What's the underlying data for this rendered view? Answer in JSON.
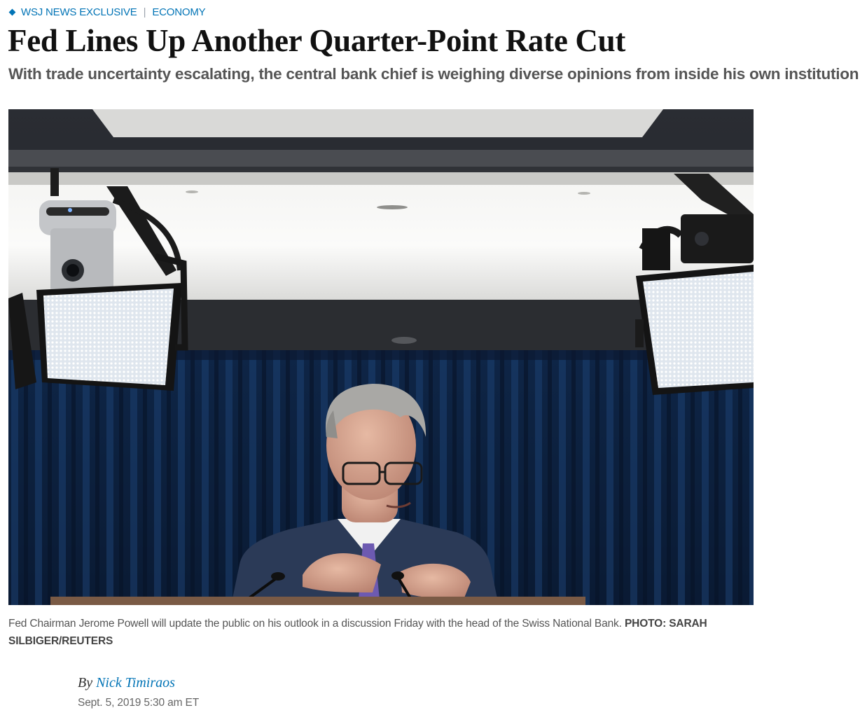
{
  "article": {
    "flashline": "WSJ NEWS EXCLUSIVE",
    "section": "ECONOMY",
    "headline": "Fed Lines Up Another Quarter-Point Rate Cut",
    "dek": "With trade uncertainty escalating, the central bank chief is weighing diverse opinions from inside his own institution",
    "caption": {
      "text": "Fed Chairman Jerome Powell will update the public on his outlook in a discussion Friday with the head of the Swiss National Bank. ",
      "credit": "PHOTO: SARAH SILBIGER/REUTERS"
    },
    "byline": {
      "prefix": "By",
      "author": "Nick Timiraos"
    },
    "timestamp": "Sept. 5, 2019 5:30 am ET"
  },
  "colors": {
    "accent": "#0274b6",
    "headline": "#111111",
    "dek": "#555555"
  },
  "icons": {
    "flashline_marker": "diamond-icon"
  }
}
